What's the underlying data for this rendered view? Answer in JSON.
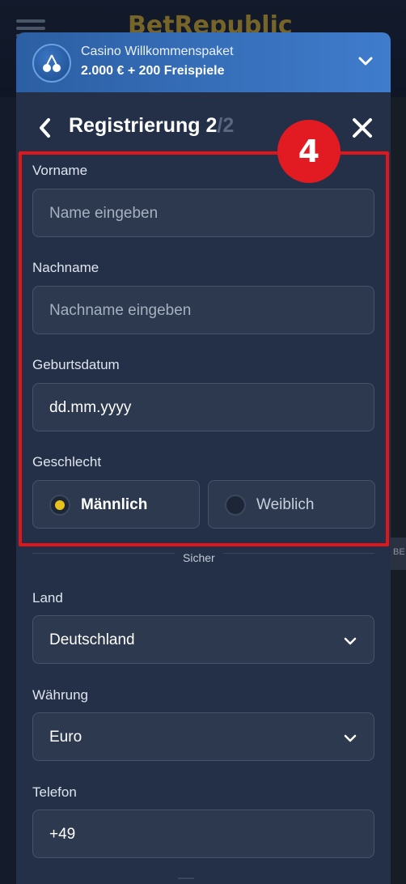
{
  "background": {
    "logo": "BetRepublic",
    "side_tag": "BE"
  },
  "promo": {
    "title": "Casino Willkommenspaket",
    "subtitle": "2.000 € + 200 Freispiele",
    "icon": "cherries-icon"
  },
  "header": {
    "title_main": "Registrierung 2",
    "title_muted": "/2"
  },
  "badge": "4",
  "form": {
    "vorname": {
      "label": "Vorname",
      "placeholder": "Name eingeben"
    },
    "nachname": {
      "label": "Nachname",
      "placeholder": "Nachname eingeben"
    },
    "geburtsdatum": {
      "label": "Geburtsdatum",
      "placeholder": "dd.mm.yyyy"
    },
    "geschlecht": {
      "label": "Geschlecht",
      "options": [
        {
          "label": "Männlich",
          "selected": true
        },
        {
          "label": "Weiblich",
          "selected": false
        }
      ]
    },
    "sicher": "Sicher",
    "land": {
      "label": "Land",
      "value": "Deutschland"
    },
    "waehrung": {
      "label": "Währung",
      "value": "Euro"
    },
    "telefon": {
      "label": "Telefon",
      "value": "+49"
    }
  },
  "colors": {
    "modal_bg": "#233047",
    "promo_accent": "#3f7ccc",
    "highlight": "#e0161b",
    "radio_selected": "#e8c21c"
  }
}
